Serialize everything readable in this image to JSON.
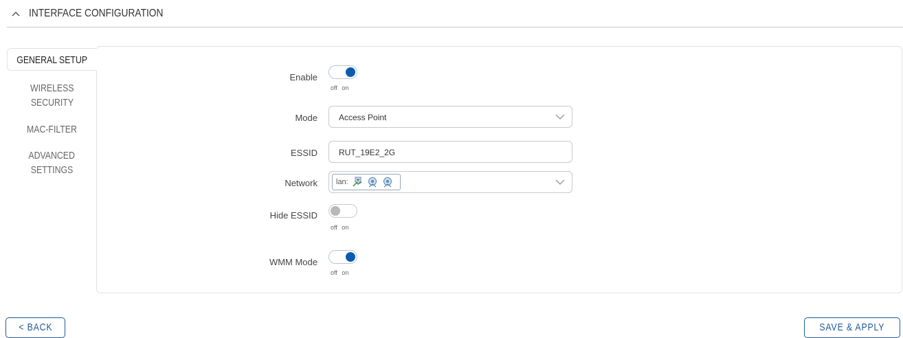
{
  "section": {
    "title": "INTERFACE CONFIGURATION"
  },
  "tabs": [
    {
      "label": "GENERAL SETUP",
      "active": true
    },
    {
      "label": "WIRELESS SECURITY",
      "active": false
    },
    {
      "label": "MAC-FILTER",
      "active": false
    },
    {
      "label": "ADVANCED SETTINGS",
      "active": false
    }
  ],
  "tab_lines": {
    "general": "GENERAL SETUP",
    "wireless_1": "WIRELESS",
    "wireless_2": "SECURITY",
    "macfilter": "MAC-FILTER",
    "advanced_1": "ADVANCED",
    "advanced_2": "SETTINGS"
  },
  "form": {
    "enable": {
      "label": "Enable",
      "value": "on",
      "caption": "off on"
    },
    "mode": {
      "label": "Mode",
      "value": "Access Point"
    },
    "essid": {
      "label": "ESSID",
      "value": "RUT_19E2_2G"
    },
    "network": {
      "label": "Network",
      "chip_text": "lan:"
    },
    "hide_essid": {
      "label": "Hide ESSID",
      "value": "off",
      "caption": "off on"
    },
    "wmm_mode": {
      "label": "WMM Mode",
      "value": "on",
      "caption": "off on"
    }
  },
  "buttons": {
    "back": "< BACK",
    "save": "SAVE & APPLY"
  },
  "colors": {
    "accent": "#0b5cad",
    "button_border": "#1f5a98"
  }
}
